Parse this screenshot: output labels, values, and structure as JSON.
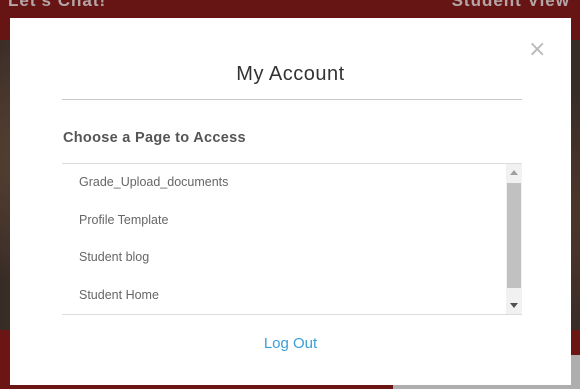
{
  "background": {
    "header_left_text": "Let's Chat!",
    "header_right_text": "Student View"
  },
  "modal": {
    "title": "My Account",
    "close_label": "×",
    "section_label": "Choose a Page to Access",
    "pages": [
      "Grade_Upload_documents",
      "Profile Template",
      "Student blog",
      "Student Home"
    ],
    "logout_label": "Log Out"
  },
  "colors": {
    "accent_link": "#3a9ed9",
    "brand_maroon": "#8f1d1d"
  }
}
